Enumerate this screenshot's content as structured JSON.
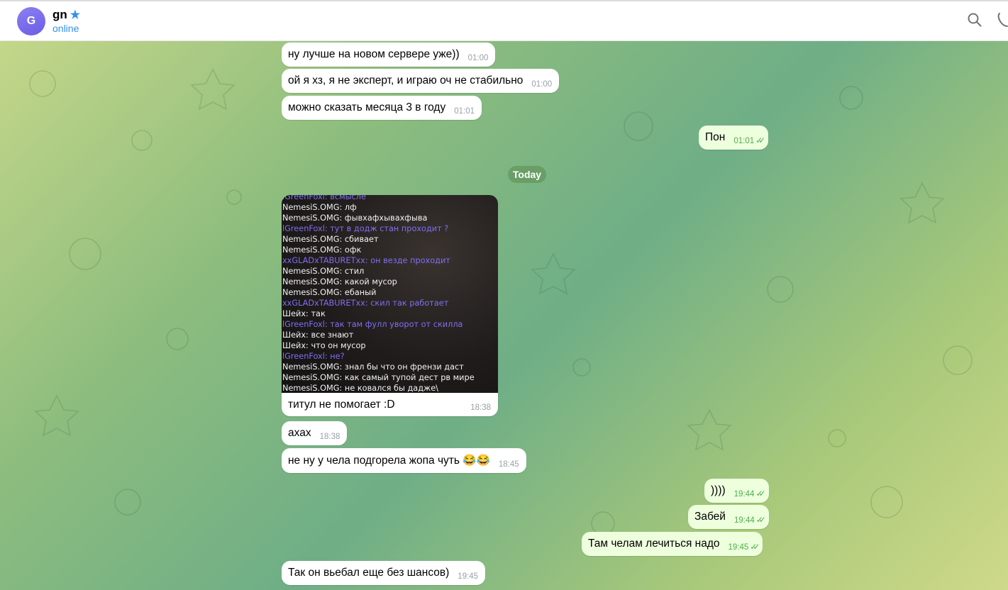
{
  "header": {
    "avatar_letter": "G",
    "contact_name": "gn",
    "status": "online",
    "star_icon": "premium-star-icon"
  },
  "date_separator": "Today",
  "messages_before": [
    {
      "text": "ну лучше на новом сервере уже))",
      "time": "01:00",
      "dir": "in"
    },
    {
      "text": "ой я хз, я не эксперт, и играю оч не стабильно",
      "time": "01:00",
      "dir": "in"
    },
    {
      "text": "можно сказать месяца 3 в году",
      "time": "01:01",
      "dir": "in"
    },
    {
      "text": "Пон",
      "time": "01:01",
      "dir": "out"
    }
  ],
  "photo_message": {
    "caption": "титул не помогает :D",
    "time": "18:38",
    "screenshot_lines": [
      {
        "text": "lGreenFoxl: всмысле",
        "color": "purple"
      },
      {
        "text": "NemesiS.OMG: лф",
        "color": "white"
      },
      {
        "text": "NemesiS.OMG: фывхафхывахфыва",
        "color": "white"
      },
      {
        "text": "lGreenFoxl: тут в додж стан проходит ?",
        "color": "purple"
      },
      {
        "text": "NemesiS.OMG: сбивает",
        "color": "white"
      },
      {
        "text": "NemesiS.OMG: офк",
        "color": "white"
      },
      {
        "text": "xxGLADxTABURETxx: он везде проходит",
        "color": "purple"
      },
      {
        "text": "NemesiS.OMG: стил",
        "color": "white"
      },
      {
        "text": "NemesiS.OMG: какой мусор",
        "color": "white"
      },
      {
        "text": "NemesiS.OMG: ебаный",
        "color": "white"
      },
      {
        "text": "xxGLADxTABURETxx: скил так работает",
        "color": "purple"
      },
      {
        "text": "Шейх: так",
        "color": "white"
      },
      {
        "text": "lGreenFoxl: так там фулл уворот от скилла",
        "color": "purple"
      },
      {
        "text": "Шейх: все знают",
        "color": "white"
      },
      {
        "text": "Шейх: что он мусор",
        "color": "white"
      },
      {
        "text": "lGreenFoxl: не?",
        "color": "purple"
      },
      {
        "text": "NemesiS.OMG: знал бы что он френзи даст",
        "color": "white"
      },
      {
        "text": "NemesiS.OMG: как самый тупой дест рв мире",
        "color": "white"
      },
      {
        "text": "NemesiS.OMG: не ковался бы дадже\\",
        "color": "white"
      }
    ]
  },
  "messages_after": [
    {
      "text": "ахах",
      "time": "18:38",
      "dir": "in"
    },
    {
      "text": "не ну у чела подгорела жопа чуть 😂😂",
      "time": "18:45",
      "dir": "in"
    },
    {
      "text": "))))",
      "time": "19:44",
      "dir": "out"
    },
    {
      "text": "Забей",
      "time": "19:44",
      "dir": "out"
    },
    {
      "text": "Там челам лечиться надо",
      "time": "19:45",
      "dir": "out"
    },
    {
      "text": "Так он вьебал еще без шансов)",
      "time": "19:45",
      "dir": "in"
    }
  ],
  "colors": {
    "accent": "#3390ec",
    "out_bubble": "#eeffde",
    "read_ticks": "#4fae4e"
  }
}
